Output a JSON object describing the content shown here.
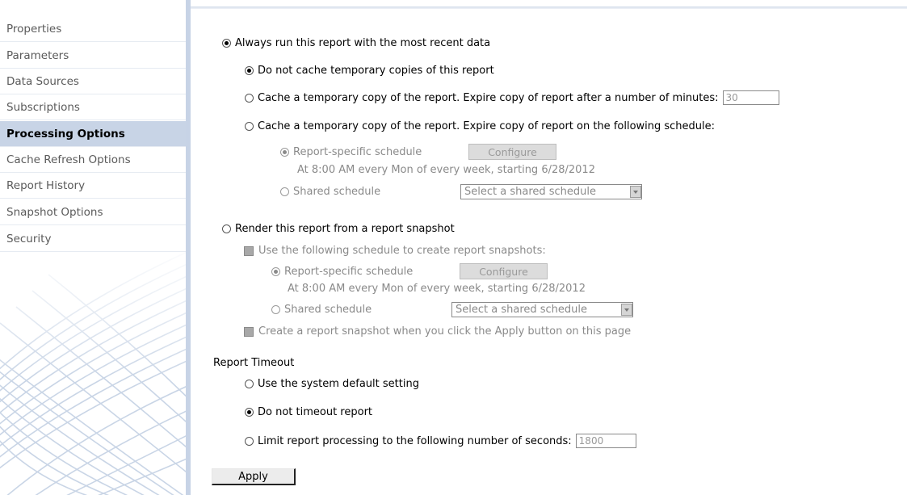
{
  "sidebar": {
    "items": [
      {
        "label": "Properties"
      },
      {
        "label": "Parameters"
      },
      {
        "label": "Data Sources"
      },
      {
        "label": "Subscriptions"
      },
      {
        "label": "Processing Options"
      },
      {
        "label": "Cache Refresh Options"
      },
      {
        "label": "Report History"
      },
      {
        "label": "Snapshot Options"
      },
      {
        "label": "Security"
      }
    ],
    "active_index": 4
  },
  "options": {
    "always_recent": "Always run this report with the most recent data",
    "no_cache": "Do not cache temporary copies of this report",
    "cache_minutes": "Cache a temporary copy of the report. Expire copy of report after a number of minutes:",
    "cache_minutes_value": "30",
    "cache_schedule": "Cache a temporary copy of the report. Expire copy of report on the following schedule:",
    "cache_sched": {
      "report_specific": "Report-specific schedule",
      "configure": "Configure",
      "schedule_text": "At 8:00 AM every Mon of every week, starting 6/28/2012",
      "shared": "Shared schedule",
      "shared_select": "Select a shared schedule"
    },
    "render_snapshot": "Render this report from a report snapshot",
    "snapshot": {
      "use_schedule": "Use the following schedule to create report snapshots:",
      "report_specific": "Report-specific schedule",
      "configure": "Configure",
      "schedule_text": "At 8:00 AM every Mon of every week, starting 6/28/2012",
      "shared": "Shared schedule",
      "shared_select": "Select a shared schedule",
      "create_on_apply": "Create a report snapshot when you click the Apply button on this page"
    }
  },
  "timeout": {
    "heading": "Report Timeout",
    "system_default": "Use the system default setting",
    "no_timeout": "Do not timeout report",
    "limit": "Limit report processing to the following number of seconds:",
    "limit_value": "1800"
  },
  "apply_label": "Apply",
  "colors": {
    "active_nav_bg": "#c8d4e6",
    "divider": "#c7d3e6",
    "disabled_text": "#8a8a8a"
  }
}
